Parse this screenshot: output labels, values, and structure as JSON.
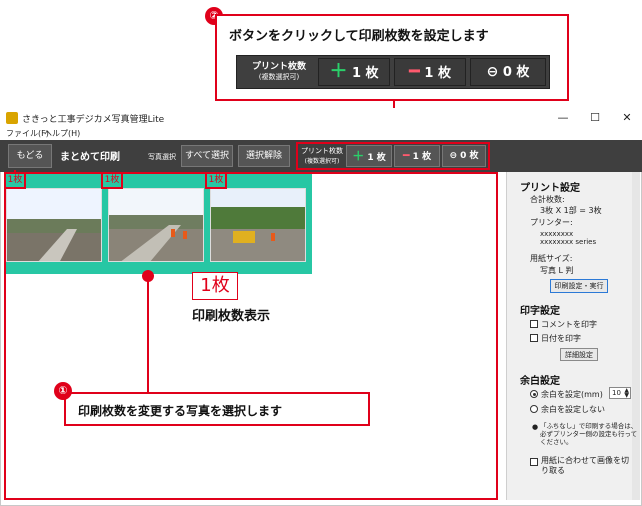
{
  "callout_top": {
    "number": "②",
    "text": "ボタンをクリックして印刷枚数を設定します",
    "print_count_line1": "プリント枚数",
    "print_count_line2": "(複数選択可)",
    "plus_label": "1 枚",
    "minus_label": "1 枚",
    "zero_label": "0 枚"
  },
  "window": {
    "title": "さきっと工事デジカメ写真管理Lite",
    "minimize": "—",
    "maximize": "☐",
    "close": "✕"
  },
  "menu": [
    "ファイル(F)",
    "ヘルプ(H)"
  ],
  "toolbar": {
    "back": "もどる",
    "title": "まとめて印刷",
    "photo_select_label": "写真選択",
    "select_all": "すべて選択",
    "deselect": "選択解除",
    "print_count_line1": "プリント枚数",
    "print_count_line2": "(複数選択可)",
    "plus": "1 枚",
    "minus": "1 枚",
    "zero": "0 枚"
  },
  "photos": [
    {
      "count": "1枚"
    },
    {
      "count": "1枚"
    },
    {
      "count": "1枚"
    }
  ],
  "annotation": {
    "big_count": "1枚",
    "big_label": "印刷枚数表示"
  },
  "callout_bottom": {
    "number": "①",
    "text": "印刷枚数を変更する写真を選択します"
  },
  "side": {
    "print_settings": "プリント設定",
    "total_label": "合計枚数:",
    "total_value": "3枚 X 1部 = 3枚",
    "printer_label": "プリンター:",
    "printer_line1": "xxxxxxxx",
    "printer_line2": "xxxxxxxx series",
    "paper_label": "用紙サイズ:",
    "paper_value": "写真 L 判",
    "print_exec_button": "印刷設定・実行",
    "imprint_settings": "印字設定",
    "comment_print": "コメントを印字",
    "date_print": "日付を印字",
    "detail_button": "詳細設定",
    "margin_settings": "余白設定",
    "margin_set": "余白を設定(mm)",
    "margin_value": "10",
    "margin_none": "余白を設定しない",
    "note": "「ふちなし」で印刷する場合は、必ずプリンター側の設定も行ってください。",
    "fit_crop": "用紙に合わせて画像を切り取る"
  }
}
